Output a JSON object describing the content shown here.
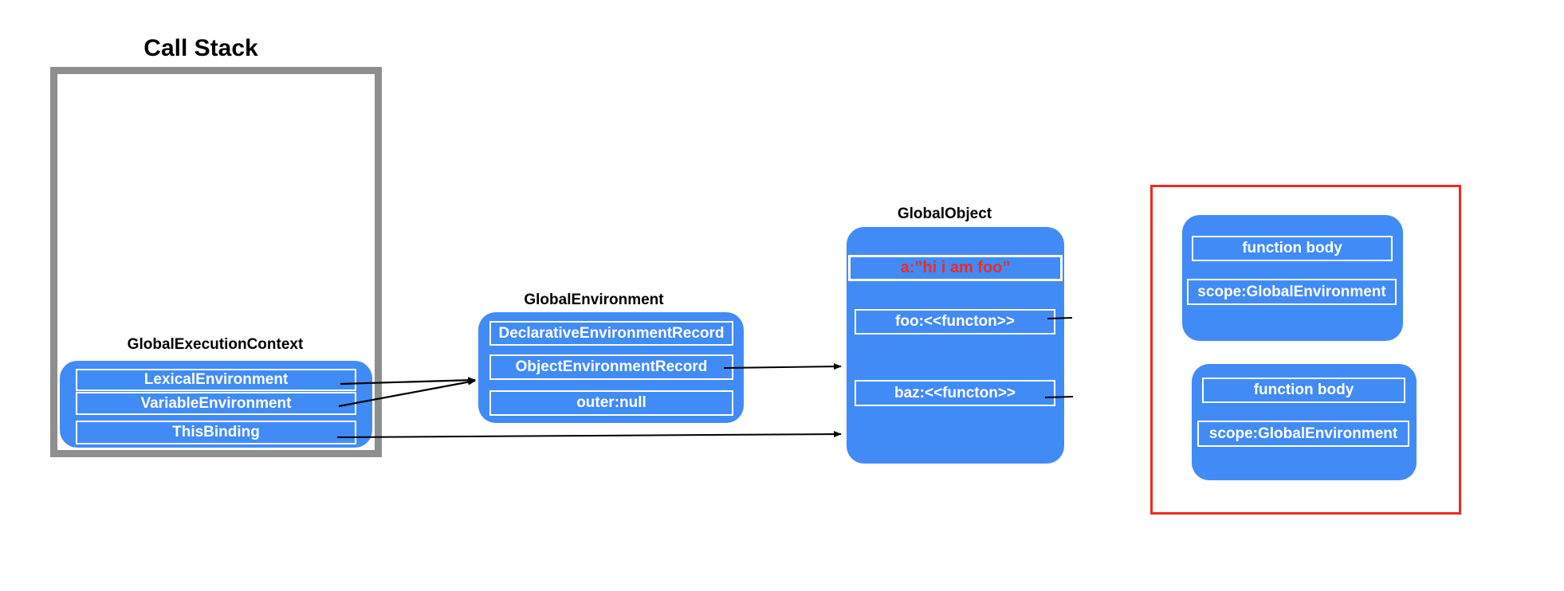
{
  "call_stack": {
    "title": "Call Stack",
    "frame_color": "#8e8e8e"
  },
  "global_execution_context": {
    "label": "GlobalExecutionContext",
    "rows": [
      "LexicalEnvironment",
      "VariableEnvironment",
      "ThisBinding"
    ]
  },
  "global_environment": {
    "label": "GlobalEnvironment",
    "rows": [
      "DeclarativeEnvironmentRecord",
      "ObjectEnvironmentRecord",
      "outer:null"
    ]
  },
  "global_object": {
    "label": "GlobalObject",
    "highlighted_row": "a:”hi i am foo”",
    "rows": [
      "foo:<<functon>>",
      "baz:<<functon>>"
    ],
    "highlight_color": "#ee2a24"
  },
  "function_objects": [
    {
      "body": "function body",
      "scope": "scope:GlobalEnvironment"
    },
    {
      "body": "function body",
      "scope": "scope:GlobalEnvironment"
    }
  ],
  "colors": {
    "box_blue": "#418bf7",
    "highlight_red": "#ee2a24"
  },
  "connections": [
    {
      "from": "LexicalEnvironment",
      "to": "GlobalEnvironment"
    },
    {
      "from": "VariableEnvironment",
      "to": "GlobalEnvironment"
    },
    {
      "from": "ObjectEnvironmentRecord",
      "to": "GlobalObject"
    },
    {
      "from": "ThisBinding",
      "to": "GlobalObject"
    },
    {
      "from": "foo:<<functon>>",
      "to": "(dangling)"
    },
    {
      "from": "baz:<<functon>>",
      "to": "(dangling)"
    }
  ]
}
